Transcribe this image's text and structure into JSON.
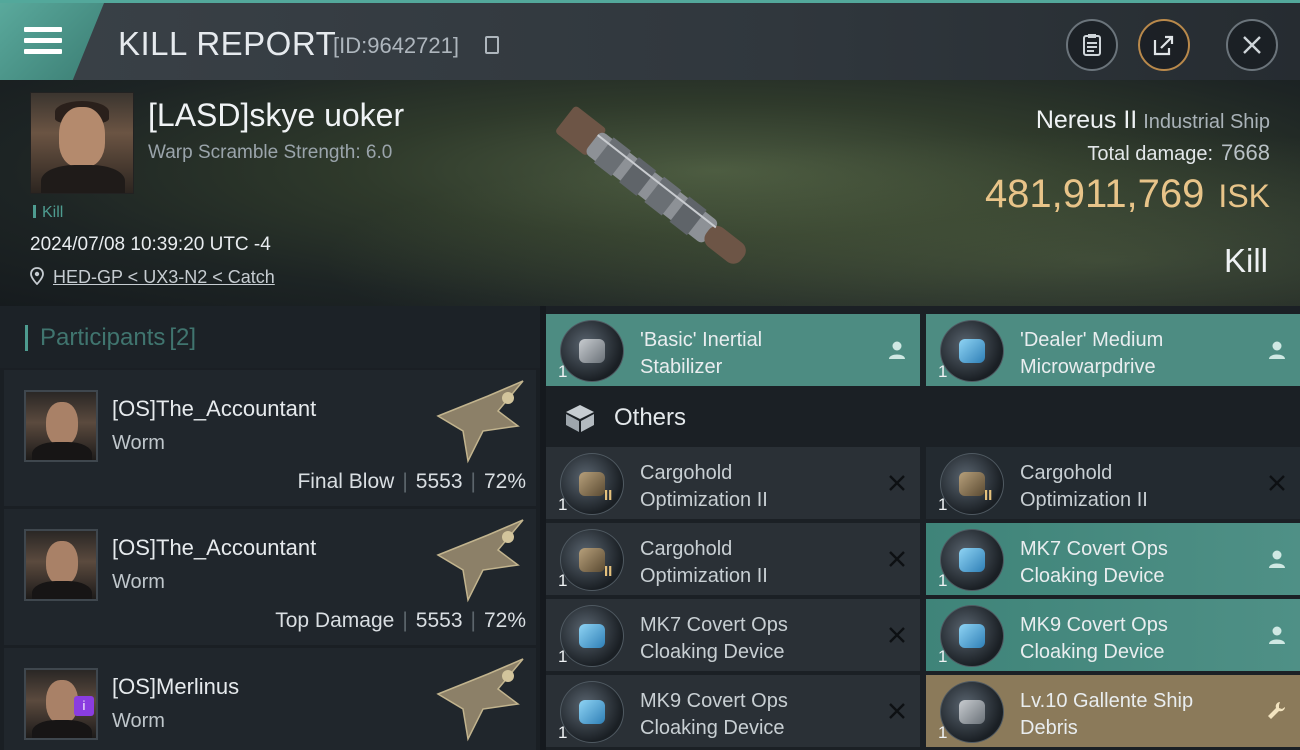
{
  "header": {
    "title": "KILL REPORT",
    "report_id": "[ID:9642721]"
  },
  "victim": {
    "name": "[LASD]skye uoker",
    "warp_scramble": "Warp Scramble Strength: 6.0",
    "tag": "Kill",
    "datetime": "2024/07/08 10:39:20 UTC -4",
    "location": "HED-GP < UX3-N2 < Catch",
    "ship_name": "Nereus II",
    "ship_class": "Industrial Ship",
    "total_damage_label": "Total damage:",
    "total_damage": "7668",
    "isk_value": "481,911,769",
    "isk_unit": "ISK",
    "result": "Kill"
  },
  "participants": {
    "title": "Participants",
    "count": "[2]",
    "rows": [
      {
        "name": "[OS]The_Accountant",
        "ship": "Worm",
        "role": "Final Blow",
        "damage": "5553",
        "percent": "72%"
      },
      {
        "name": "[OS]The_Accountant",
        "ship": "Worm",
        "role": "Top Damage",
        "damage": "5553",
        "percent": "72%"
      },
      {
        "name": "[OS]Merlinus",
        "ship": "Worm",
        "badge": "i"
      }
    ]
  },
  "items": {
    "fitted": [
      {
        "qty": "1",
        "name_line1": "'Basic' Inertial",
        "name_line2": "Stabilizer",
        "status": "pilot"
      },
      {
        "qty": "1",
        "name_line1": "'Dealer' Medium",
        "name_line2": "Microwarpdrive",
        "status": "pilot"
      }
    ],
    "others_title": "Others",
    "others": [
      {
        "qty": "1",
        "tier": "II",
        "name_line1": "Cargohold",
        "name_line2": "Optimization II",
        "status": "destroyed"
      },
      {
        "qty": "1",
        "tier": "II",
        "name_line1": "Cargohold",
        "name_line2": "Optimization II",
        "status": "destroyed"
      },
      {
        "qty": "1",
        "tier": "II",
        "name_line1": "Cargohold",
        "name_line2": "Optimization II",
        "status": "destroyed"
      },
      {
        "qty": "1",
        "name_line1": "MK7 Covert Ops",
        "name_line2": "Cloaking Device",
        "status": "pilot"
      },
      {
        "qty": "1",
        "name_line1": "MK7 Covert Ops",
        "name_line2": "Cloaking Device",
        "status": "destroyed"
      },
      {
        "qty": "1",
        "name_line1": "MK9 Covert Ops",
        "name_line2": "Cloaking Device",
        "status": "pilot"
      },
      {
        "qty": "1",
        "name_line1": "MK9 Covert Ops",
        "name_line2": "Cloaking Device",
        "status": "destroyed"
      },
      {
        "qty": "1",
        "name_line1": "Lv.10 Gallente Ship",
        "name_line2": "Debris",
        "status": "wrench"
      }
    ]
  },
  "colors": {
    "accent": "#53a89b",
    "isk_gold": "#e8c489",
    "fitted_bg": "#4d8c82",
    "special_bg": "#8b7a5a"
  }
}
